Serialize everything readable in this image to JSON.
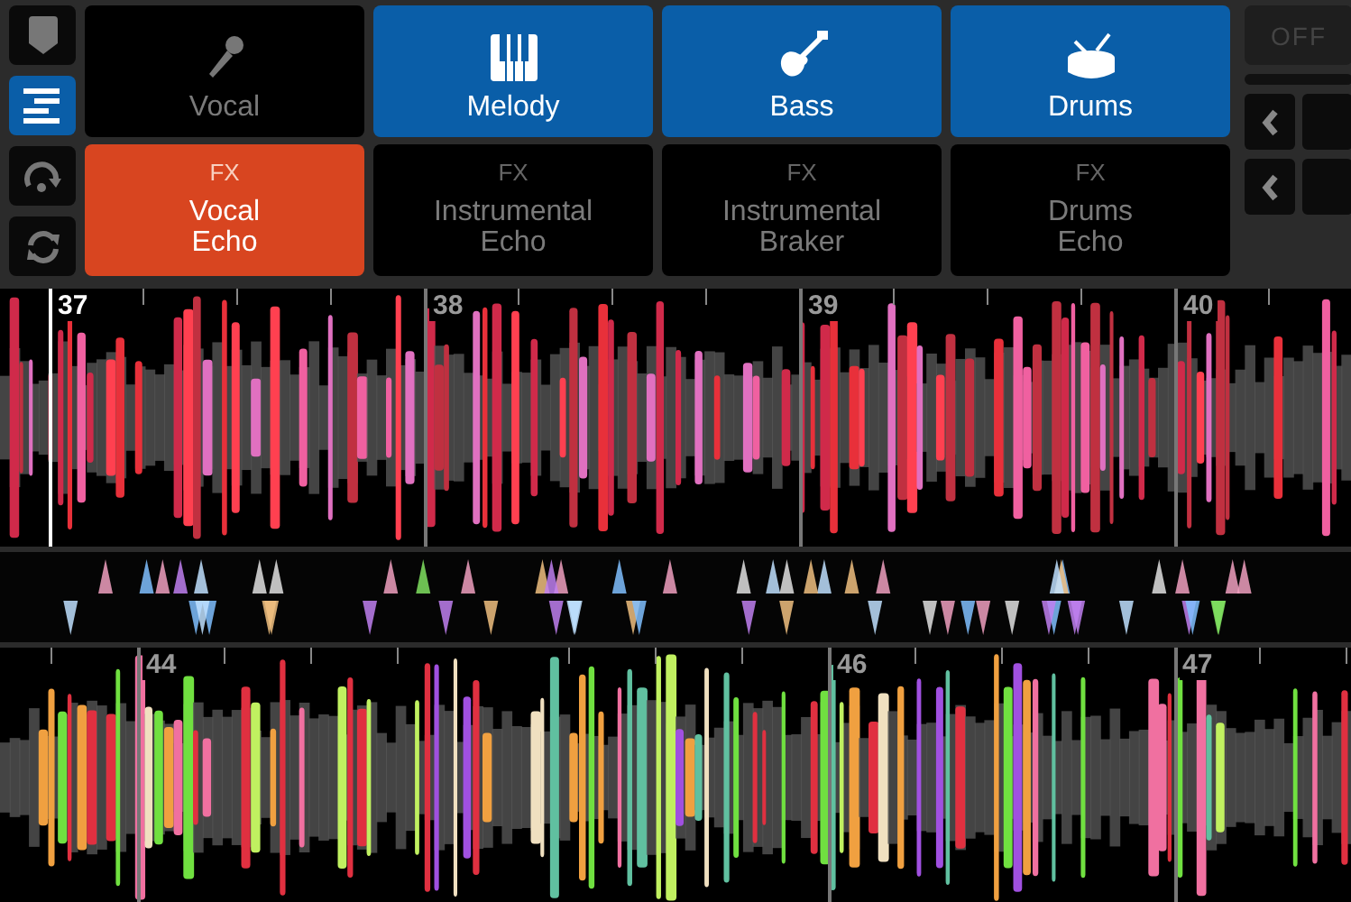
{
  "side_buttons": [
    {
      "kind": "cue",
      "selected": false
    },
    {
      "kind": "lanes",
      "selected": true
    },
    {
      "kind": "loop",
      "selected": false
    },
    {
      "kind": "sync",
      "selected": false
    }
  ],
  "instrument_pads": [
    {
      "kind": "mic",
      "label": "Vocal",
      "selected": false
    },
    {
      "kind": "keys",
      "label": "Melody",
      "selected": true
    },
    {
      "kind": "guitar",
      "label": "Bass",
      "selected": true
    },
    {
      "kind": "drum",
      "label": "Drums",
      "selected": true
    }
  ],
  "fx_pads": [
    {
      "tag": "FX",
      "label": "Vocal\nEcho",
      "selected": true
    },
    {
      "tag": "FX",
      "label": "Instrumental\nEcho",
      "selected": false
    },
    {
      "tag": "FX",
      "label": "Instrumental\nBraker",
      "selected": false
    },
    {
      "tag": "FX",
      "label": "Drums\nEcho",
      "selected": false
    }
  ],
  "right_panel": {
    "off_button": "OFF"
  },
  "deck_top": {
    "beats": [
      {
        "label": "37",
        "playhead": true
      },
      {
        "label": "38",
        "playhead": false
      },
      {
        "label": "39",
        "playhead": false
      },
      {
        "label": "40",
        "playhead": false
      }
    ]
  },
  "deck_bottom": {
    "beats": [
      {
        "label": "44",
        "playhead": false
      },
      {
        "label": "46",
        "playhead": false
      },
      {
        "label": "47",
        "playhead": false
      }
    ]
  }
}
